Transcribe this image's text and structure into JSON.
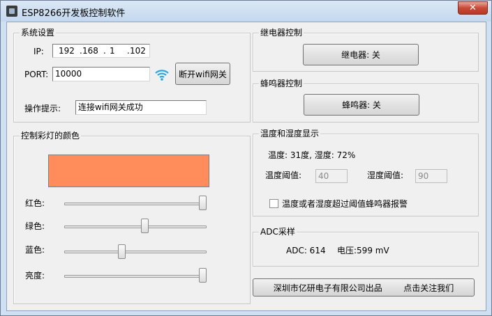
{
  "window": {
    "title": "ESP8266开发板控制软件",
    "close_glyph": "✕"
  },
  "system": {
    "title": "系统设置",
    "ip_label": "IP:",
    "ip_octets": [
      "192",
      "168",
      "1",
      "102"
    ],
    "ip_separator": ".",
    "port_label": "PORT:",
    "port_value": "10000",
    "wifi_icon": "wifi-icon",
    "disconnect_label": "断开wifi网关",
    "hint_label": "操作提示:",
    "hint_value": "连接wifi网关成功"
  },
  "color": {
    "title": "控制彩灯的颜色",
    "swatch_color": "#ff8c5a",
    "red_label": "红色:",
    "green_label": "绿色:",
    "blue_label": "蓝色:",
    "brightness_label": "亮度:",
    "red_level": 1.0,
    "green_level": 0.57,
    "blue_level": 0.4,
    "brightness_level": 1.0
  },
  "relay": {
    "title": "继电器控制",
    "button_label": "继电器: 关"
  },
  "buzzer": {
    "title": "蜂鸣器控制",
    "button_label": "蜂鸣器: 关"
  },
  "env": {
    "title": "温度和湿度显示",
    "reading": "温度: 31度, 湿度: 72%",
    "temp_threshold_label": "温度阈值:",
    "temp_threshold_value": "40",
    "humidity_threshold_label": "湿度阈值:",
    "humidity_threshold_value": "90",
    "alarm_checkbox_label": "温度或者湿度超过阈值蜂鸣器报警"
  },
  "adc": {
    "title": "ADC采样",
    "adc_text": "ADC: 614",
    "voltage_text": "电压:599 mV"
  },
  "footer": {
    "button_label": "深圳市亿研电子有限公司出品        点击关注我们"
  }
}
